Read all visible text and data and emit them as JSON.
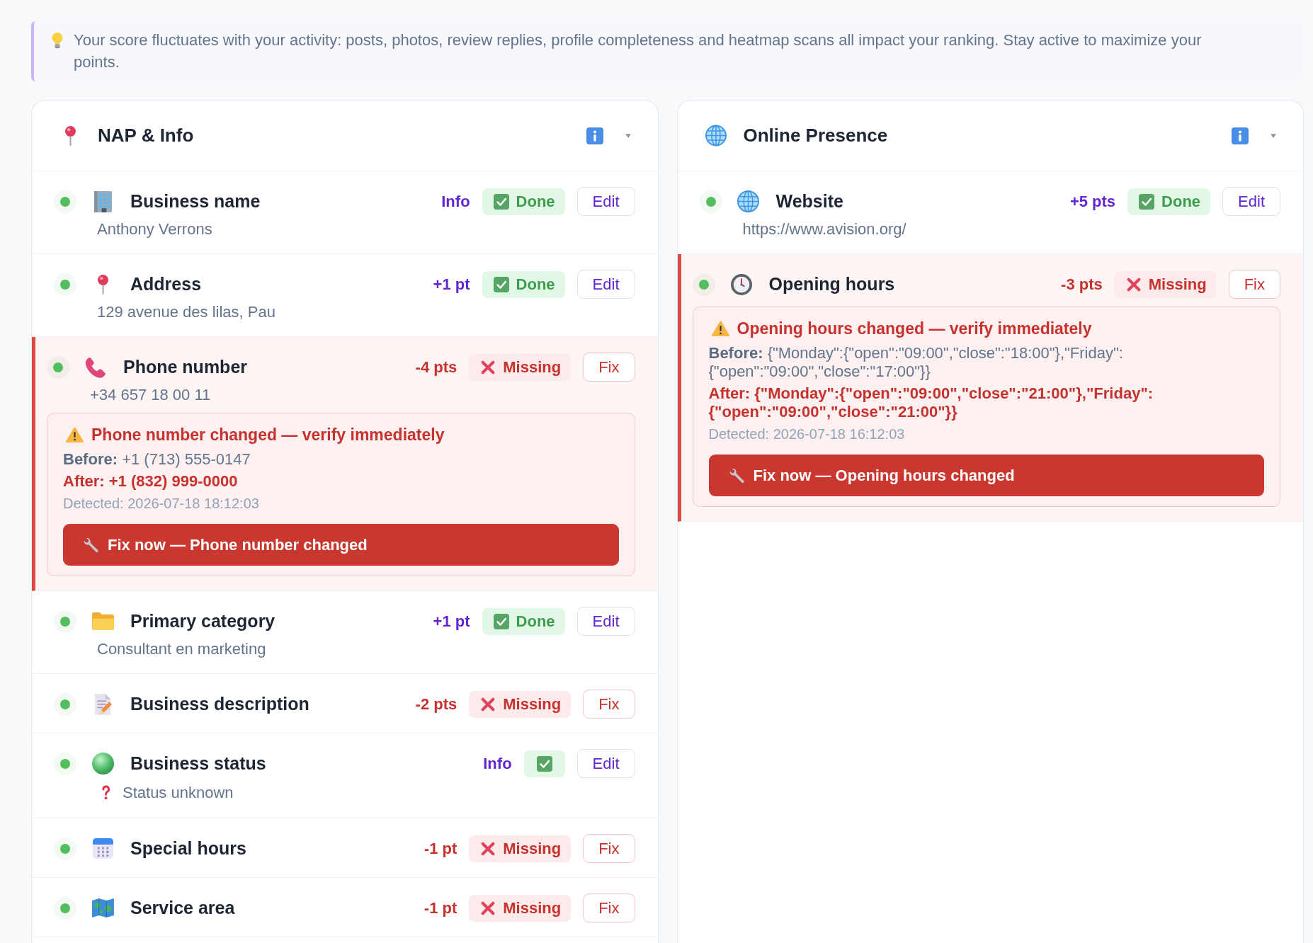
{
  "tip": {
    "text": "Your score fluctuates with your activity: posts, photos, review replies, profile completeness and heatmap scans all impact your ranking. Stay active to maximize your points."
  },
  "sections": [
    {
      "title": "NAP & Info",
      "expanded": true,
      "items": [
        {
          "label": "Business name",
          "value": "Anthony Verrons",
          "points": "Info",
          "complete": true,
          "status_text": "Done",
          "action": "Edit"
        },
        {
          "label": "Address",
          "value": "129 avenue des lilas, Pau",
          "points": "+1 pt",
          "complete": true,
          "status_text": "Done",
          "action": "Edit"
        },
        {
          "label": "Phone number",
          "value": "+34 657 18 00 11",
          "points": "-4 pts",
          "complete": false,
          "status_text": "Missing",
          "action": "Fix",
          "alert": {
            "title": "Phone number changed — verify immediately",
            "before": "**Before:** +1 (713) 555-0147",
            "after": "After: +1 (832) 999-0000",
            "detected": "Detected: 2026-07-18 18:12:03",
            "button": "Fix now — Phone number changed"
          }
        },
        {
          "label": "Primary category",
          "value": "Consultant en marketing",
          "points": "+1 pt",
          "complete": true,
          "status_text": "Done",
          "action": "Edit"
        },
        {
          "label": "Business description",
          "points": "-2 pts",
          "complete": false,
          "status_text": "Missing",
          "action": "Fix"
        },
        {
          "label": "Business status",
          "value": "Status unknown",
          "value_unknown": true,
          "points": "Info",
          "complete": true,
          "action": "Edit"
        },
        {
          "label": "Special hours",
          "points": "-1 pt",
          "complete": false,
          "status_text": "Missing",
          "action": "Fix"
        },
        {
          "label": "Service area",
          "points": "-1 pt",
          "complete": false,
          "status_text": "Missing",
          "action": "Fix"
        }
      ]
    },
    {
      "title": "Online Presence",
      "expanded": true,
      "items": [
        {
          "label": "Website",
          "value": "https://www.avision.org/",
          "points": "+5 pts",
          "complete": true,
          "status_text": "Done",
          "action": "Edit"
        },
        {
          "label": "Opening hours",
          "points": "-3 pts",
          "complete": false,
          "status_text": "Missing",
          "action": "Fix",
          "alert": {
            "title": "Opening hours changed — verify immediately",
            "before": "**Before:** {\"Monday\":{\"open\":\"09:00\",\"close\":\"18:00\"},\"Friday\":{\"open\":\"09:00\",\"close\":\"17:00\"}}",
            "after": "After: {\"Monday\":{\"open\":\"09:00\",\"close\":\"21:00\"},\"Friday\":{\"open\":\"09:00\",\"close\":\"21:00\"}}",
            "detected": "Detected: 2026-07-18 16:12:03",
            "button": "Fix now — Opening hours changed"
          }
        }
      ]
    }
  ]
}
